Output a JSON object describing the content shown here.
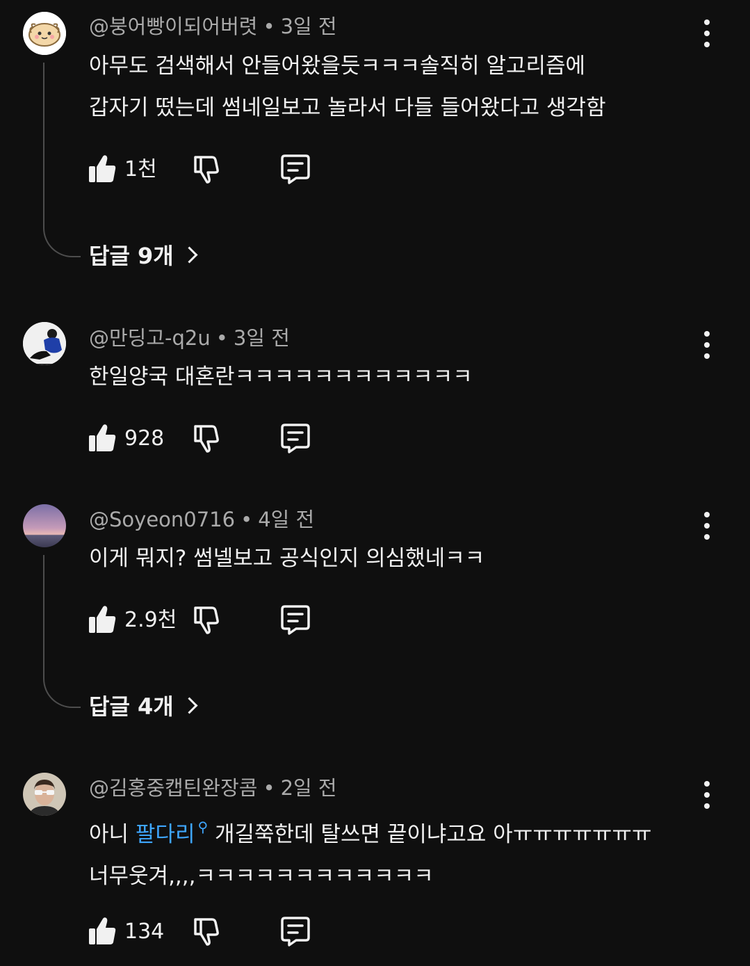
{
  "comments": [
    {
      "author": "@붕어빵이되어버렷",
      "time": "3일 전",
      "lines": [
        "아무도 검색해서 안들어왔을듯ㅋㅋㅋ솔직히 알고리즘에",
        "갑자기 떴는데 썸네일보고 놀라서 다들 들어왔다고 생각함"
      ],
      "likes": "1천",
      "replies_label": "답글 9개"
    },
    {
      "author": "@만딩고-q2u",
      "time": "3일 전",
      "lines": [
        "한일양국 대혼란ㅋㅋㅋㅋㅋㅋㅋㅋㅋㅋㅋㅋ"
      ],
      "likes": "928"
    },
    {
      "author": "@Soyeon0716",
      "time": "4일 전",
      "lines": [
        "이게 뭐지? 썸넬보고 공식인지 의심했네ㅋㅋ"
      ],
      "likes": "2.9천",
      "replies_label": "답글 4개"
    },
    {
      "author": "@김홍중캡틴완장콤",
      "time": "2일 전",
      "line1_before": "아니 ",
      "line1_link": "팔다리",
      "line1_after": " 개길쭉한데 탈쓰면 끝이냐고요 아ㅠㅠㅠㅠㅠㅠㅠ",
      "line2": "너무웃겨,,,,ㅋㅋㅋㅋㅋㅋㅋㅋㅋㅋㅋㅋ",
      "likes": "134"
    }
  ],
  "separator": "•",
  "icons": {
    "like": "thumbs-up-icon",
    "dislike": "thumbs-down-icon",
    "reply": "comment-reply-icon",
    "more": "more-vertical-icon",
    "search_link": "search-icon",
    "chevron": "chevron-right-icon"
  },
  "colors": {
    "background": "#0f0f0f",
    "text": "#f1f1f1",
    "secondary_text": "#aaaaaa",
    "link": "#3ea6ff",
    "thread_line": "#4d4d4d"
  }
}
